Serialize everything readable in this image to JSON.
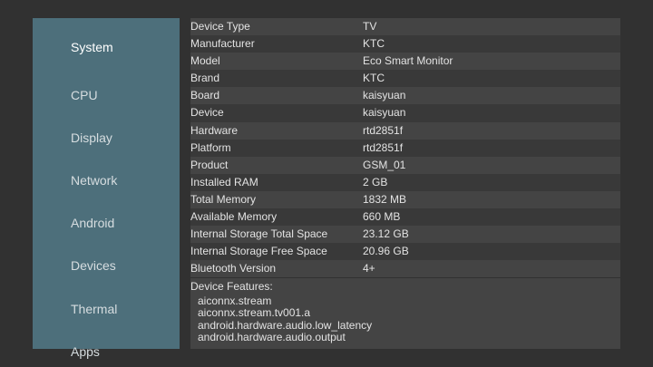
{
  "sidebar": {
    "items": [
      {
        "label": "System",
        "active": true
      },
      {
        "label": "CPU",
        "active": false
      },
      {
        "label": "Display",
        "active": false
      },
      {
        "label": "Network",
        "active": false
      },
      {
        "label": "Android",
        "active": false
      },
      {
        "label": "Devices",
        "active": false
      },
      {
        "label": "Thermal",
        "active": false
      },
      {
        "label": "Apps",
        "active": false
      }
    ]
  },
  "system_info": {
    "rows": [
      {
        "key": "Device Type",
        "value": "TV"
      },
      {
        "key": "Manufacturer",
        "value": "KTC"
      },
      {
        "key": "Model",
        "value": "Eco Smart Monitor"
      },
      {
        "key": "Brand",
        "value": "KTC"
      },
      {
        "key": "Board",
        "value": "kaisyuan"
      },
      {
        "key": "Device",
        "value": "kaisyuan"
      },
      {
        "key": "Hardware",
        "value": "rtd2851f"
      },
      {
        "key": "Platform",
        "value": "rtd2851f"
      },
      {
        "key": "Product",
        "value": "GSM_01"
      },
      {
        "key": "Installed RAM",
        "value": "2 GB"
      },
      {
        "key": "Total Memory",
        "value": "1832 MB"
      },
      {
        "key": "Available Memory",
        "value": "660 MB"
      },
      {
        "key": "Internal Storage Total Space",
        "value": "23.12 GB"
      },
      {
        "key": "Internal Storage Free Space",
        "value": "20.96 GB"
      },
      {
        "key": "Bluetooth Version",
        "value": "4+"
      }
    ]
  },
  "device_features": {
    "title": "Device Features:",
    "items": [
      "aiconnx.stream",
      "aiconnx.stream.tv001.a",
      "android.hardware.audio.low_latency",
      "android.hardware.audio.output"
    ]
  },
  "colors": {
    "background": "#313131",
    "sidebar": "#4d6f7b",
    "row_light": "#444444",
    "row_dark": "#393939"
  }
}
